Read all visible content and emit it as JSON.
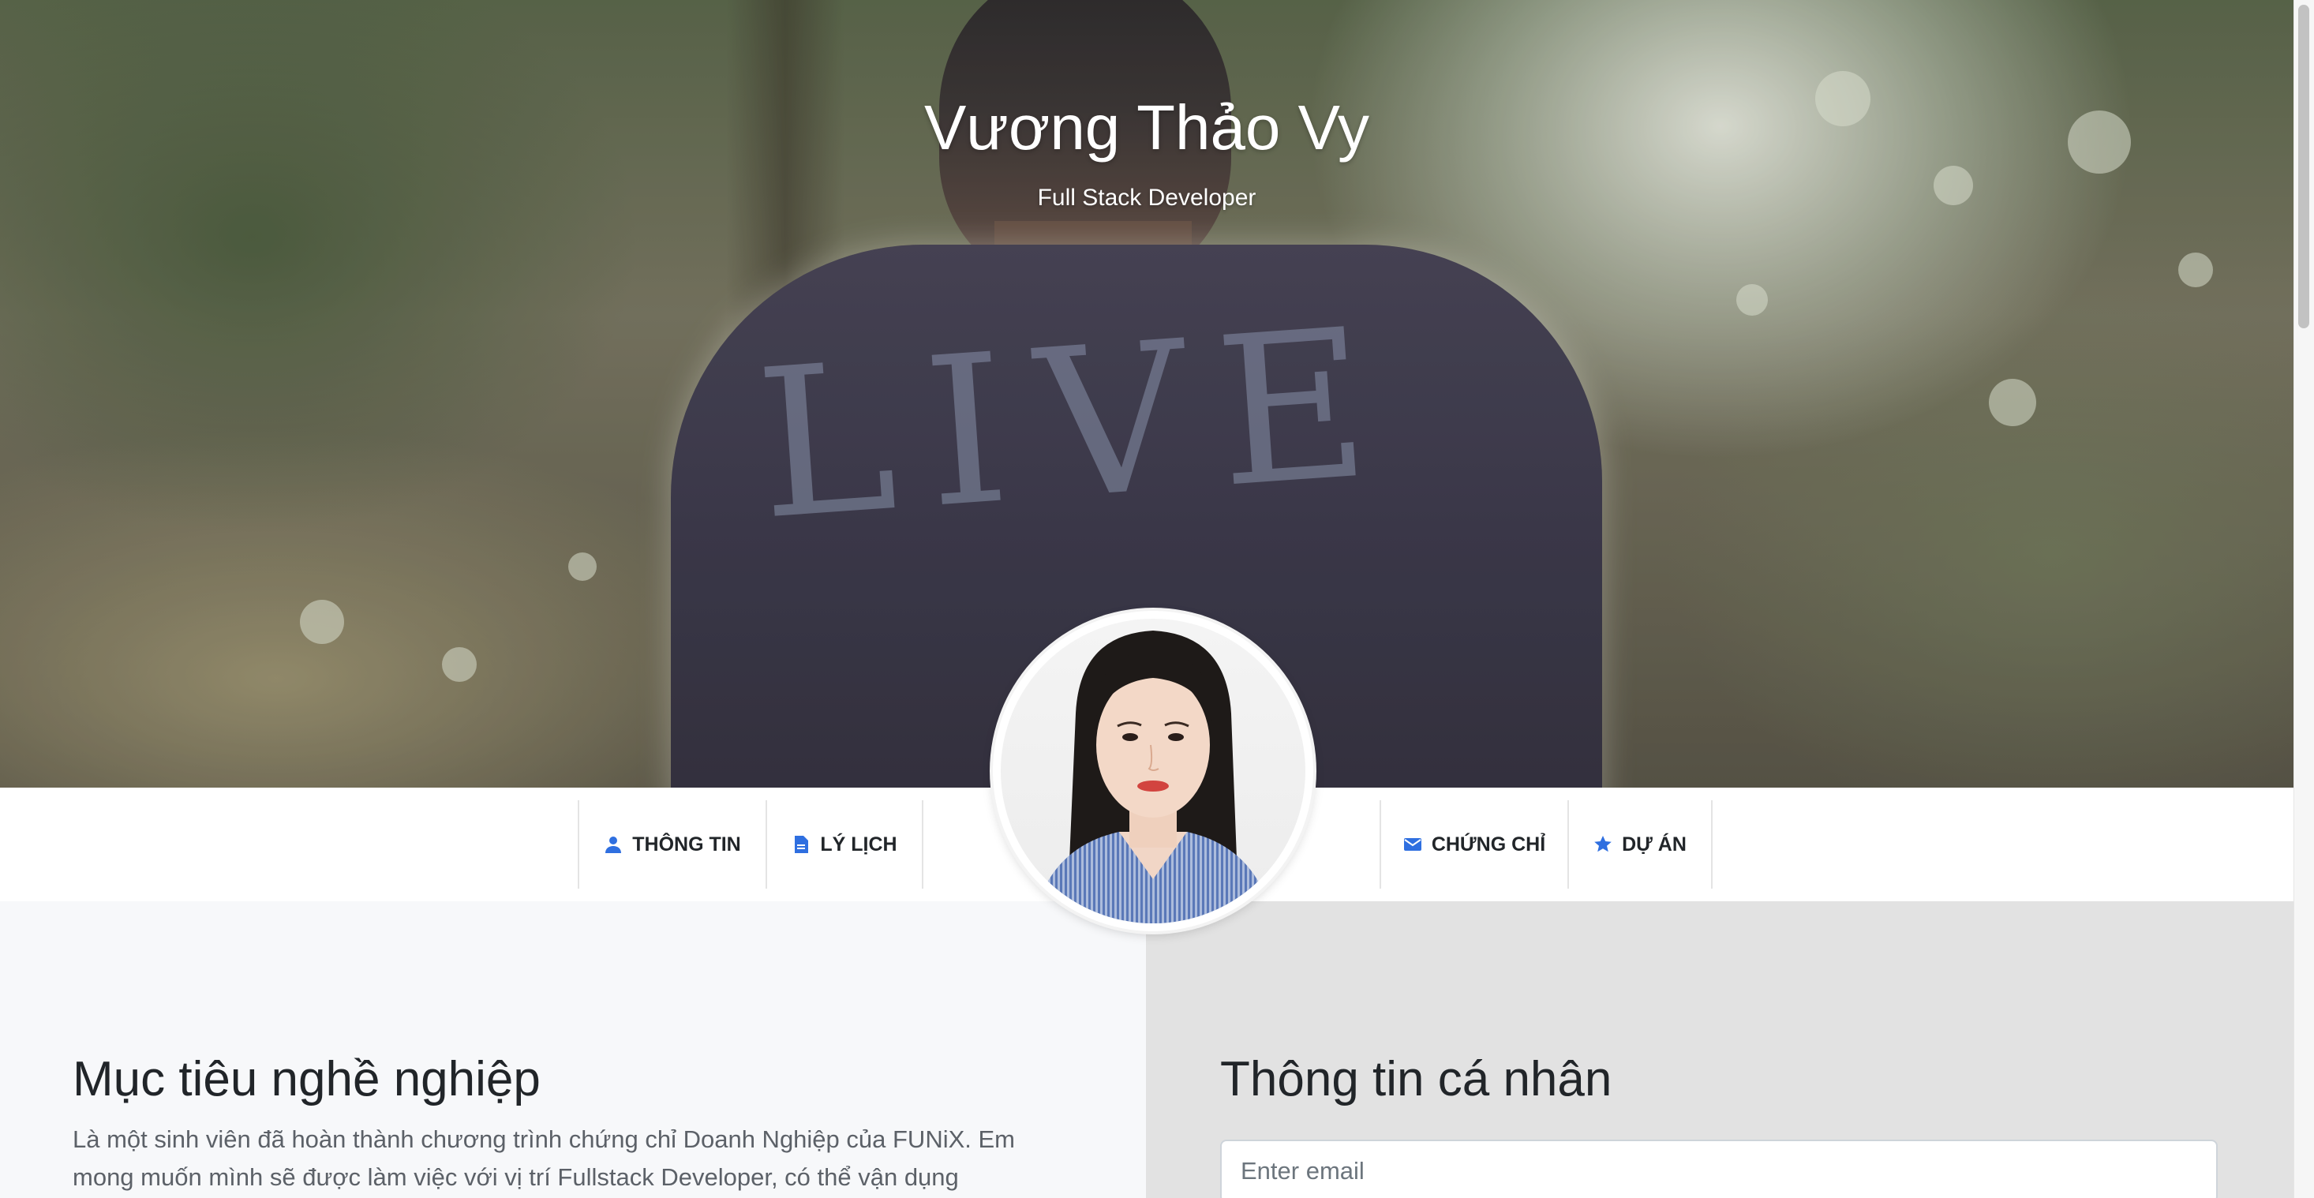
{
  "hero": {
    "name": "Vương Thảo Vy",
    "role": "Full Stack Developer",
    "shirt_text": "LIVE"
  },
  "nav": {
    "items": [
      {
        "label": "THÔNG TIN",
        "icon": "user-icon"
      },
      {
        "label": "LÝ LỊCH",
        "icon": "document-icon"
      },
      {
        "label": "CHỨNG CHỈ",
        "icon": "envelope-icon"
      },
      {
        "label": "DỰ ÁN",
        "icon": "star-icon"
      }
    ]
  },
  "career": {
    "title": "Mục tiêu nghề nghiệp",
    "text": "Là một sinh viên đã hoàn thành chương trình chứng chỉ Doanh Nghiệp của FUNiX. Em mong muốn mình sẽ được làm việc với vị trí Fullstack Developer, có thể vận dụng"
  },
  "personal": {
    "title": "Thông tin cá nhân",
    "email_placeholder": "Enter email"
  },
  "colors": {
    "accent_icon": "#2f6fe0",
    "left_panel_bg": "#f7f8fa",
    "right_panel_bg": "#e2e2e2",
    "heading_text": "#212529",
    "body_text": "#5c6168"
  }
}
